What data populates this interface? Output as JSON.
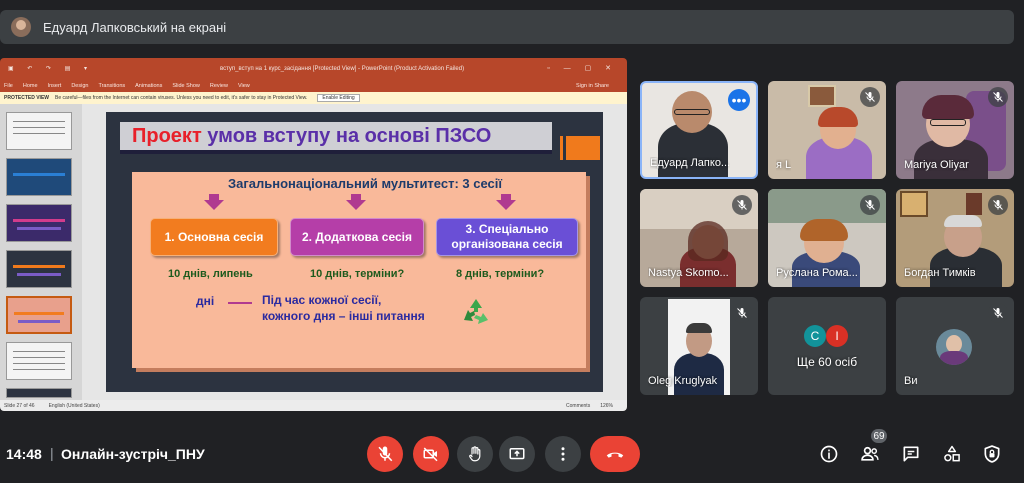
{
  "banner": {
    "presenter_text": "Едуард Лапковський на екрані"
  },
  "powerpoint": {
    "window_title": "вступ_вступ на 1 курс_засідання [Protected View] - PowerPoint (Product Activation Failed)",
    "ribbon_tabs": [
      "File",
      "Home",
      "Insert",
      "Design",
      "Transitions",
      "Animations",
      "Slide Show",
      "Review",
      "View"
    ],
    "ribbon_right": "Sign in   Share",
    "protected_label": "PROTECTED VIEW",
    "protected_text": "Be careful—files from the Internet can contain viruses. Unless you need to edit, it's safer to stay in Protected View.",
    "enable_editing": "Enable Editing",
    "status_slide": "Slide 27 of 46",
    "status_lang": "English (United States)",
    "status_notes": "Comments",
    "status_zoom": "126%"
  },
  "slide": {
    "title_word1": "Проект",
    "title_rest": " умов вступу на основі ПЗСО",
    "multitest": "Загальнонаціональний мультитест: 3 сесії",
    "session1": "1. Основна сесія",
    "session2": "2. Додаткова сесія",
    "session3_line1": "3. Спеціально",
    "session3_line2": "організована сесія",
    "info1": "10 днів, липень",
    "info2": "10 днів, терміни?",
    "info3": "8 днів, терміни?",
    "days_word": "дні",
    "during_line1": "Під час кожної сесії,",
    "during_line2": "кожного дня – інші питання"
  },
  "participants": [
    {
      "name": "Едуард Лапко...",
      "speaking": true
    },
    {
      "name": "я L",
      "muted": true
    },
    {
      "name": "Mariya Oliyar",
      "muted": true
    },
    {
      "name": "Nastya Skomo...",
      "muted": true
    },
    {
      "name": "Руслана Рома...",
      "muted": true
    },
    {
      "name": "Богдан Тимків",
      "muted": true
    },
    {
      "name": "Oleg Kruglyak",
      "muted": true
    },
    {
      "name": "Ще 60 осіб",
      "avatars": [
        "C",
        "I"
      ]
    },
    {
      "name": "Ви",
      "muted": true
    }
  ],
  "bottom_bar": {
    "time": "14:48",
    "separator": "|",
    "meeting_title": "Онлайн-зустріч_ПНУ",
    "participant_count": "69"
  },
  "colors": {
    "bg": "#202124",
    "red": "#ea4335",
    "blue": "#1a73e8",
    "ppt": "#b7472a"
  }
}
